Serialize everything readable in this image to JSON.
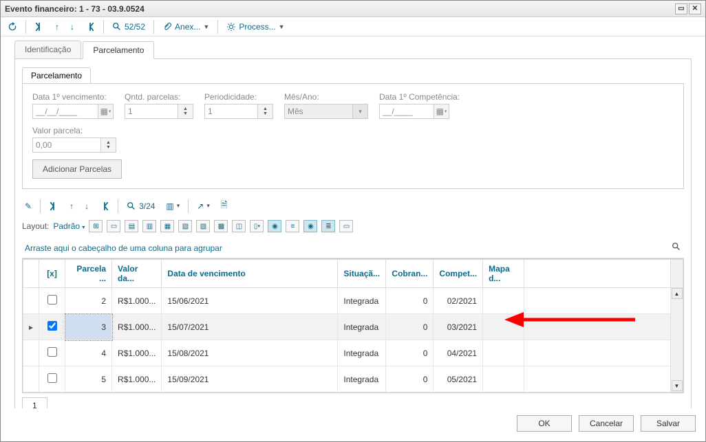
{
  "window": {
    "title": "Evento financeiro: 1 - 73 - 03.9.0524"
  },
  "toolbar": {
    "count": "52/52",
    "anex": "Anex...",
    "process": "Process..."
  },
  "tabs": {
    "identificacao": "Identificação",
    "parcelamento_outer": "Parcelamento",
    "parcelamento_inner": "Parcelamento"
  },
  "form": {
    "data1venc_label": "Data 1º vencimento:",
    "data1venc_value": "__/__/____",
    "qntd_label": "Qntd. parcelas:",
    "qntd_value": "1",
    "period_label": "Periodicidade:",
    "period_value": "1",
    "mesano_label": "Mês/Ano:",
    "mesano_value": "Mês",
    "data1comp_label": "Data 1º Competência:",
    "data1comp_value": "__/____",
    "valor_label": "Valor parcela:",
    "valor_value": "0,00",
    "add_btn": "Adicionar Parcelas"
  },
  "subtoolbar": {
    "count": "3/24"
  },
  "layout": {
    "label": "Layout:",
    "value": "Padrão"
  },
  "group_hint": "Arraste aqui o cabeçalho de uma coluna para agrupar",
  "columns": {
    "chk": "[x]",
    "parcela": "Parcela ...",
    "valor": "Valor da...",
    "data_venc": "Data de vencimento",
    "situacao": "Situaçã...",
    "cobranca": "Cobran...",
    "compet": "Compet...",
    "mapa": "Mapa d..."
  },
  "rows": [
    {
      "checked": false,
      "parcela": "2",
      "valor": "R$1.000...",
      "data": "15/06/2021",
      "sit": "Integrada",
      "cob": "0",
      "comp": "02/2021",
      "mapa": ""
    },
    {
      "checked": true,
      "parcela": "3",
      "valor": "R$1.000...",
      "data": "15/07/2021",
      "sit": "Integrada",
      "cob": "0",
      "comp": "03/2021",
      "mapa": "",
      "selected": true
    },
    {
      "checked": false,
      "parcela": "4",
      "valor": "R$1.000...",
      "data": "15/08/2021",
      "sit": "Integrada",
      "cob": "0",
      "comp": "04/2021",
      "mapa": ""
    },
    {
      "checked": false,
      "parcela": "5",
      "valor": "R$1.000...",
      "data": "15/09/2021",
      "sit": "Integrada",
      "cob": "0",
      "comp": "05/2021",
      "mapa": ""
    }
  ],
  "pager": {
    "page": "1"
  },
  "footer": {
    "ok": "OK",
    "cancel": "Cancelar",
    "save": "Salvar"
  }
}
